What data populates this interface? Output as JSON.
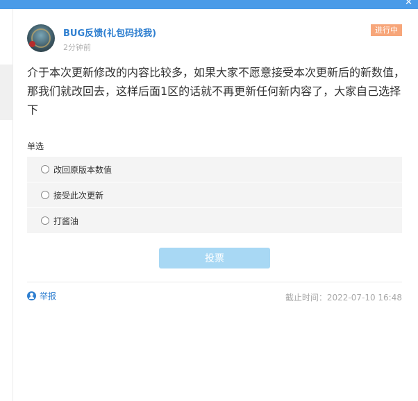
{
  "window": {
    "close_glyph": "✕",
    "accent_color": "#4a9be8"
  },
  "post": {
    "author": "BUG反馈(礼包码找我)",
    "time": "2分钟前",
    "status": "进行中",
    "status_color": "#f7a67a",
    "content": "介于本次更新修改的内容比较多，如果大家不愿意接受本次更新后的新数值，那我们就改回去，这样后面1区的话就不再更新任何新内容了，大家自己选择下"
  },
  "poll": {
    "type_label": "单选",
    "options": [
      {
        "label": "改回原版本数值"
      },
      {
        "label": "接受此次更新"
      },
      {
        "label": "打酱油"
      }
    ],
    "vote_label": "投票"
  },
  "footer": {
    "report_label": "举报",
    "report_icon": "user-report-icon",
    "deadline": "截止时间：2022-07-10 16:48"
  }
}
